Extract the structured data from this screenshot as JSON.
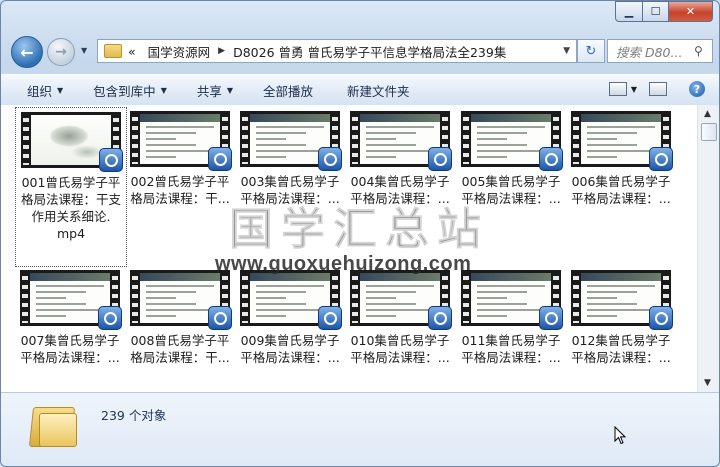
{
  "window": {
    "minimize_glyph": "▁",
    "maximize_glyph": "☐",
    "close_glyph": "✕"
  },
  "nav": {
    "back_glyph": "←",
    "forward_glyph": "→",
    "dropdown_glyph": "▼"
  },
  "address": {
    "overflow": "«",
    "crumbs": [
      "国学资源网",
      "D8026 曾勇 曾氏易学子平信息学格局法全239集"
    ],
    "separator": "▶",
    "dropdown": "▼"
  },
  "refresh_glyph": "↻",
  "search": {
    "placeholder": "搜索 D80...",
    "icon": "⚲"
  },
  "toolbar": {
    "organize": "组织",
    "include_library": "包含到库中",
    "share": "共享",
    "play_all": "全部播放",
    "new_folder": "新建文件夹",
    "dropdown_arrow": "▼",
    "help": "?"
  },
  "items": [
    {
      "lines": [
        "001曾氏易学子平",
        "格局法课程：干支",
        "作用关系细论.",
        "mp4"
      ]
    },
    {
      "lines": [
        "002曾氏易学子平",
        "格局法课程：干..."
      ]
    },
    {
      "lines": [
        "003集曾氏易学子",
        "平格局法课程：..."
      ]
    },
    {
      "lines": [
        "004集曾氏易学子",
        "平格局法课程：..."
      ]
    },
    {
      "lines": [
        "005集曾氏易学子",
        "平格局法课程：..."
      ]
    },
    {
      "lines": [
        "006集曾氏易学子",
        "平格局法课程：..."
      ]
    },
    {
      "lines": [
        "007集曾氏易学子",
        "平格局法课程：..."
      ]
    },
    {
      "lines": [
        "008曾氏易学子平",
        "格局法课程：干..."
      ]
    },
    {
      "lines": [
        "009集曾氏易学子",
        "平格局法课程：..."
      ]
    },
    {
      "lines": [
        "010集曾氏易学子",
        "平格局法课程：..."
      ]
    },
    {
      "lines": [
        "011集曾氏易学子",
        "平格局法课程：..."
      ]
    },
    {
      "lines": [
        "012集曾氏易学子",
        "平格局法课程：..."
      ]
    }
  ],
  "watermark": {
    "title": "国学汇总站",
    "url": "www.guoxuehuizong.com"
  },
  "details": {
    "count": "239 个对象"
  }
}
